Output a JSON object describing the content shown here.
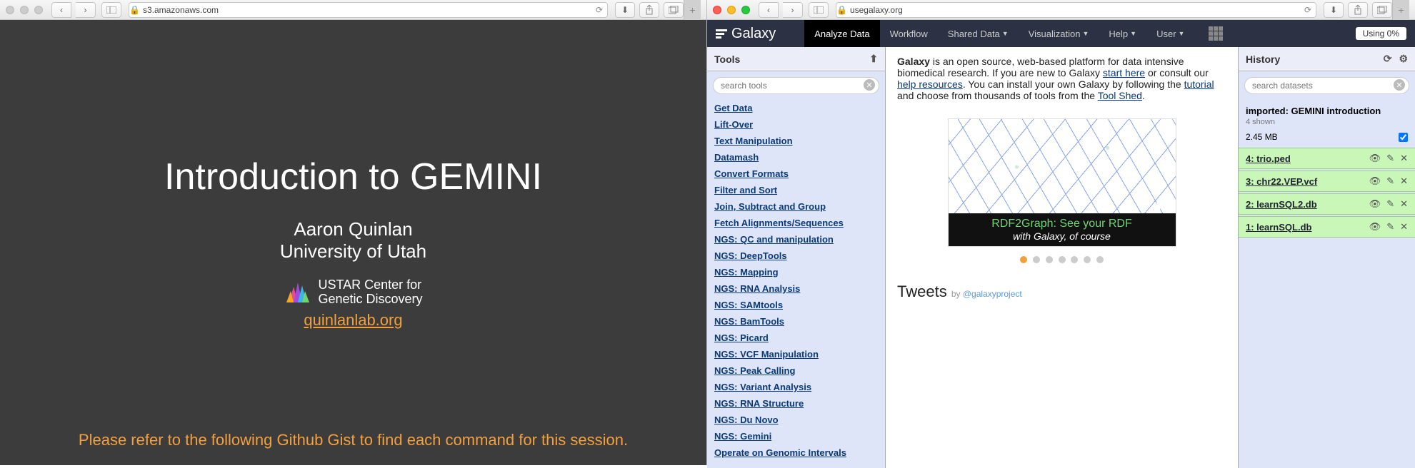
{
  "left": {
    "url": "s3.amazonaws.com",
    "slide": {
      "title": "Introduction to GEMINI",
      "author": "Aaron Quinlan",
      "affiliation": "University of Utah",
      "center_line1": "USTAR Center for",
      "center_line2": "Genetic Discovery",
      "link": "quinlanlab.org",
      "footer": "Please refer to the following Github Gist to find each command for this session."
    }
  },
  "right": {
    "url": "usegalaxy.org",
    "nav": {
      "logo": "Galaxy",
      "items": [
        "Analyze Data",
        "Workflow",
        "Shared Data",
        "Visualization",
        "Help",
        "User"
      ],
      "usage": "Using 0%"
    },
    "tools": {
      "header": "Tools",
      "search_placeholder": "search tools",
      "categories": [
        "Get Data",
        "Lift-Over",
        "Text Manipulation",
        "Datamash",
        "Convert Formats",
        "Filter and Sort",
        "Join, Subtract and Group",
        "Fetch Alignments/Sequences",
        "NGS: QC and manipulation",
        "NGS: DeepTools",
        "NGS: Mapping",
        "NGS: RNA Analysis",
        "NGS: SAMtools",
        "NGS: BamTools",
        "NGS: Picard",
        "NGS: VCF Manipulation",
        "NGS: Peak Calling",
        "NGS: Variant Analysis",
        "NGS: RNA Structure",
        "NGS: Du Novo",
        "NGS: Gemini",
        "Operate on Genomic Intervals"
      ]
    },
    "center": {
      "intro_bold": "Galaxy",
      "intro1": " is an open source, web-based platform for data intensive biomedical research. If you are new to Galaxy ",
      "start_here": "start here",
      "intro2": " or consult our ",
      "help_resources": "help resources",
      "intro3": ". You can install your own Galaxy by following the ",
      "tutorial": "tutorial",
      "intro4": " and choose from thousands of tools from the ",
      "tool_shed": "Tool Shed",
      "intro5": ".",
      "carousel_title": "RDF2Graph: See your RDF",
      "carousel_sub": "with Galaxy, of course",
      "tweets_label": "Tweets",
      "tweets_by": "by ",
      "tweets_handle": "@galaxyproject"
    },
    "history": {
      "header": "History",
      "search_placeholder": "search datasets",
      "name": "imported: GEMINI introduction",
      "shown": "4 shown",
      "size": "2.45 MB",
      "datasets": [
        "4: trio.ped",
        "3: chr22.VEP.vcf",
        "2: learnSQL2.db",
        "1: learnSQL.db"
      ]
    }
  }
}
